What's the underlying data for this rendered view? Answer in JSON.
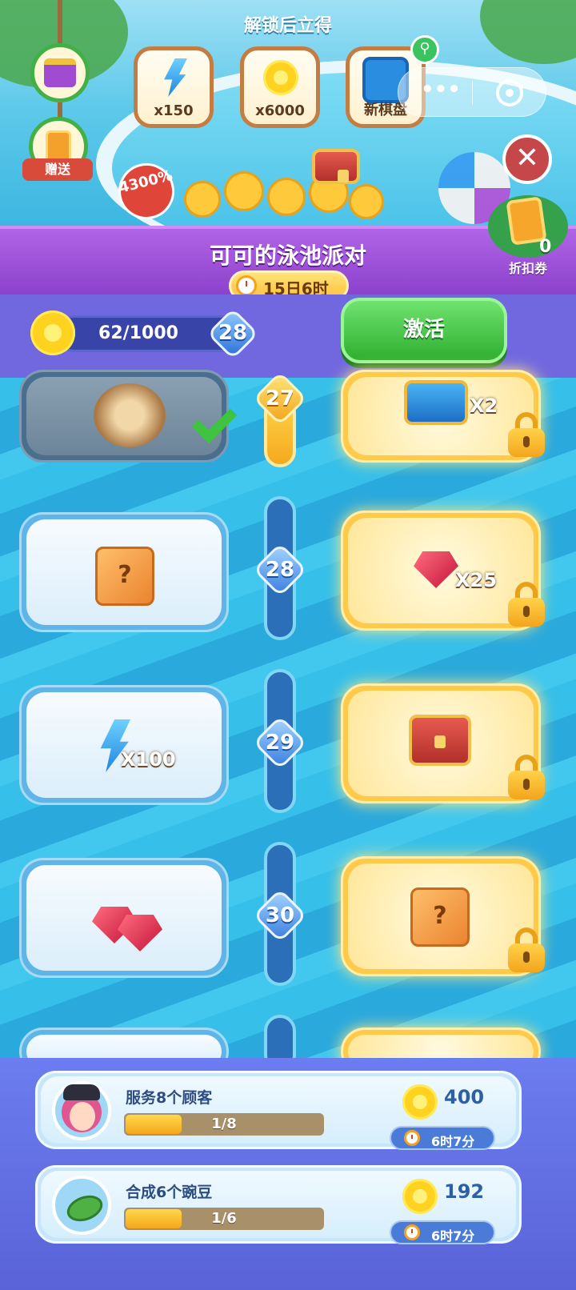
{
  "banner": {
    "unlock_title": "解锁后立得",
    "unlock_rewards": [
      {
        "label": "x150",
        "icon": "energy-bolt-icon"
      },
      {
        "label": "x6000",
        "icon": "flower-coin-icon"
      },
      {
        "label": "新棋盘",
        "icon": "new-board-icon"
      }
    ],
    "gift_label": "赠送",
    "bonus_badge": "4300%",
    "coupon_count": "0",
    "coupon_label": "折扣券"
  },
  "event": {
    "title": "可可的泳池派对",
    "timer": "15日6时"
  },
  "progress": {
    "points": "62/1000",
    "level": "28",
    "activate_label": "激活"
  },
  "track": {
    "rows": [
      {
        "level": "27",
        "free_reward": "food-platter",
        "free_claimed": true,
        "paid_reward": "blue-chest",
        "paid_qty": "X2",
        "locked": true
      },
      {
        "level": "28",
        "free_reward": "mystery-box",
        "free_claimed": false,
        "paid_reward": "ruby",
        "paid_qty": "X25",
        "locked": true
      },
      {
        "level": "29",
        "free_reward": "energy-bolt",
        "free_qty": "X100",
        "free_claimed": false,
        "paid_reward": "red-chest",
        "locked": true
      },
      {
        "level": "30",
        "free_reward": "rubies",
        "free_claimed": false,
        "paid_reward": "mystery-box",
        "locked": true
      }
    ]
  },
  "tasks": [
    {
      "title": "服务8个顾客",
      "progress_text": "1/8",
      "progress": 0.125,
      "reward": "400",
      "time_left": "6时7分",
      "icon": "customer-avatar-icon"
    },
    {
      "title": "合成6个豌豆",
      "progress_text": "1/6",
      "progress": 0.167,
      "reward": "192",
      "time_left": "6时7分",
      "icon": "pea-icon"
    }
  ],
  "colors": {
    "accent_purple": "#9a4fd8",
    "button_green": "#3cc23c",
    "pool_blue": "#2fb6e0",
    "gold": "#ffc94a"
  }
}
